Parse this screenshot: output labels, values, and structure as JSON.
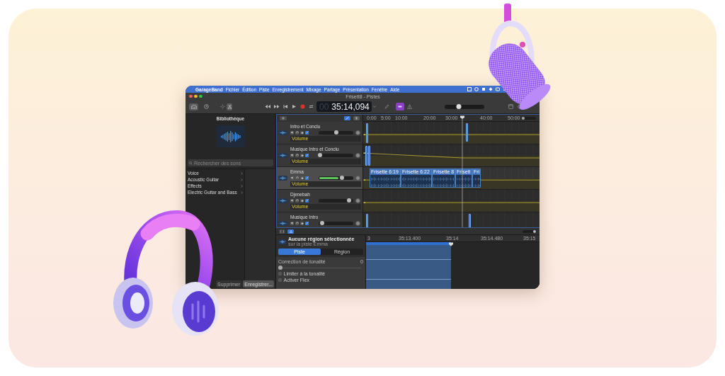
{
  "menu_bar": {
    "app": "GarageBand",
    "items": [
      "Fichier",
      "Édition",
      "Piste",
      "Enregistrement",
      "Mixage",
      "Partage",
      "Présentation",
      "Fenêtre",
      "Aide"
    ]
  },
  "window": {
    "title": "Frisett8 - Pistes"
  },
  "toolbar": {
    "lcd_dim": "00",
    "lcd": "35:14,094",
    "volume": {
      "level": 0.35
    }
  },
  "library": {
    "title": "Bibliothèque",
    "search": {
      "placeholder": "Rechercher des sons"
    },
    "items": [
      {
        "label": "Voice"
      },
      {
        "label": "Acoustic Guitar"
      },
      {
        "label": "Effects"
      },
      {
        "label": "Electric Guitar and Bass"
      }
    ],
    "buttons": [
      "Supprimer",
      "Enregistrer..."
    ]
  },
  "tracks": [
    {
      "name": "Intro et Conclu",
      "level": 0.5,
      "selected": false,
      "automation": "Volume"
    },
    {
      "name": "Musique Intro et Conclu",
      "level": 0.05,
      "selected": false,
      "automation": "Volume"
    },
    {
      "name": "Emma",
      "level": 0.68,
      "meter": {
        "level": 0.55
      },
      "selected": true,
      "automation": "Volume"
    },
    {
      "name": "Djenebah",
      "level": 0.88,
      "selected": false,
      "automation": "Volume"
    },
    {
      "name": "Musique Intro",
      "level": 0.1,
      "selected": false
    }
  ],
  "timeline": {
    "ruler": [
      "0:00",
      "5:00",
      "10:00",
      "20:00",
      "30:00",
      "40:00",
      "50:00"
    ],
    "regions": [
      "Frisette 6:19",
      "Frisette 6:22",
      "Frisette 8",
      "Frisett",
      "Fri"
    ],
    "playhead": {
      "level": 0.56
    },
    "zoom": {
      "level": 0.1
    }
  },
  "editor": {
    "title": "Aucune région sélectionnée",
    "subtitle": "sur la piste Emma",
    "segments": [
      {
        "label": "Piste",
        "selected": true
      },
      {
        "label": "Région",
        "selected": false
      }
    ],
    "pitch": {
      "label": "Correction de tonalité",
      "value": "0",
      "level": 0
    },
    "checkboxes": [
      {
        "label": "Limiter à la tonalité",
        "checked": false
      },
      {
        "label": "Activer Flex",
        "checked": false
      }
    ],
    "ruler": [
      "3",
      "35:13.400",
      "35:14",
      "35:14.480",
      "35:15"
    ],
    "playhead": {
      "level": 0.49
    },
    "zoom": {
      "level": 0.85
    }
  }
}
